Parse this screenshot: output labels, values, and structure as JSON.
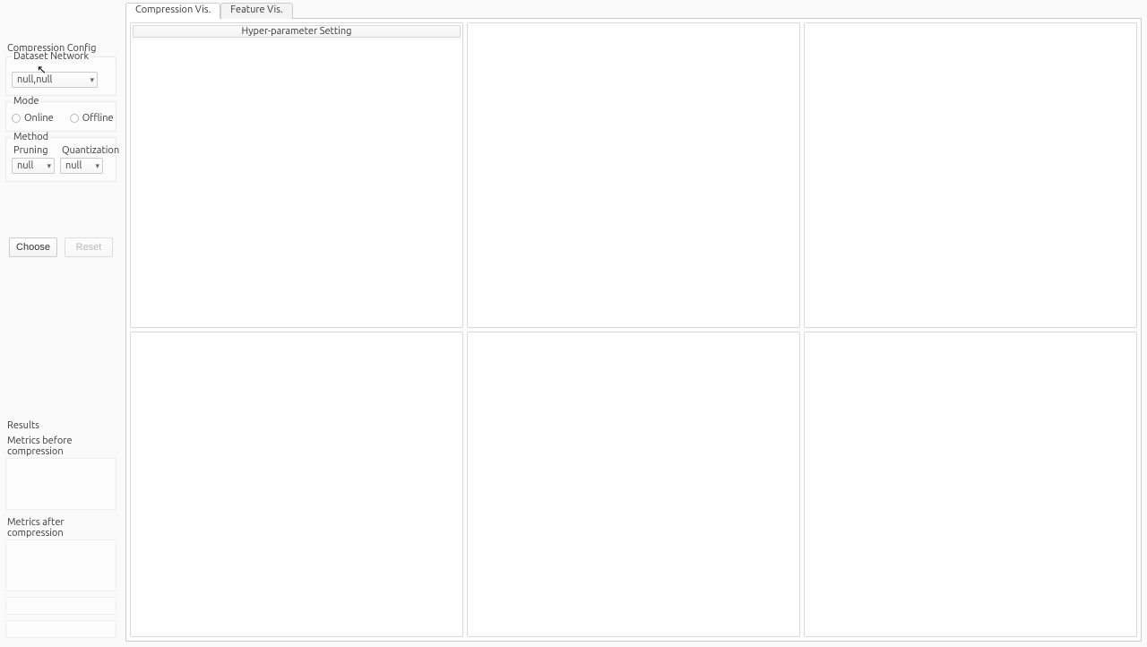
{
  "sidebar": {
    "config_title": "Compression Config",
    "dataset_network": {
      "label": "Dataset Network",
      "value": "null,null"
    },
    "mode": {
      "label": "Mode",
      "online": "Online",
      "offline": "Offline"
    },
    "method": {
      "label": "Method",
      "pruning_label": "Pruning",
      "pruning_value": "null",
      "quantization_label": "Quantization",
      "quantization_value": "null"
    },
    "choose_label": "Choose",
    "reset_label": "Reset",
    "results_title": "Results",
    "metrics_before_label": "Metrics before compression",
    "metrics_after_label": "Metrics after compression"
  },
  "tabs": {
    "compression": "Compression Vis.",
    "feature": "Feature Vis."
  },
  "main": {
    "hyperparam_header": "Hyper-parameter Setting"
  }
}
